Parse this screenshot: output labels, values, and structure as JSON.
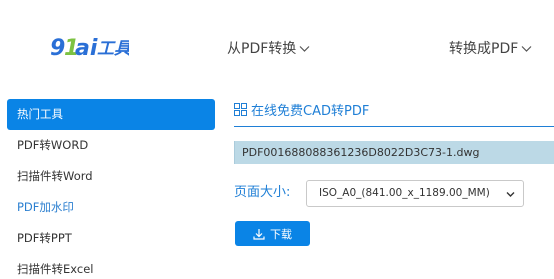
{
  "logo": {
    "text": "91ai工具"
  },
  "nav": {
    "from_pdf": "从PDF转换",
    "to_pdf": "转换成PDF"
  },
  "sidebar": {
    "items": [
      {
        "label": "热门工具",
        "active": true
      },
      {
        "label": "PDF转WORD"
      },
      {
        "label": "扫描件转Word"
      },
      {
        "label": "PDF加水印",
        "link": true
      },
      {
        "label": "PDF转PPT"
      },
      {
        "label": "扫描件转Excel"
      }
    ]
  },
  "main": {
    "section_title": "在线免费CAD转PDF",
    "file_name": "PDF001688088361236D8022D3C73-1.dwg",
    "page_size_label": "页面大小:",
    "page_size_value": "ISO_A0_(841.00_x_1189.00_MM)",
    "download_label": "下载"
  },
  "colors": {
    "accent": "#0a84e6",
    "title_blue": "#1f7fd6",
    "file_bar": "#bcd9e6",
    "logo_blue": "#2a6fd6",
    "logo_green": "#7cc242"
  }
}
